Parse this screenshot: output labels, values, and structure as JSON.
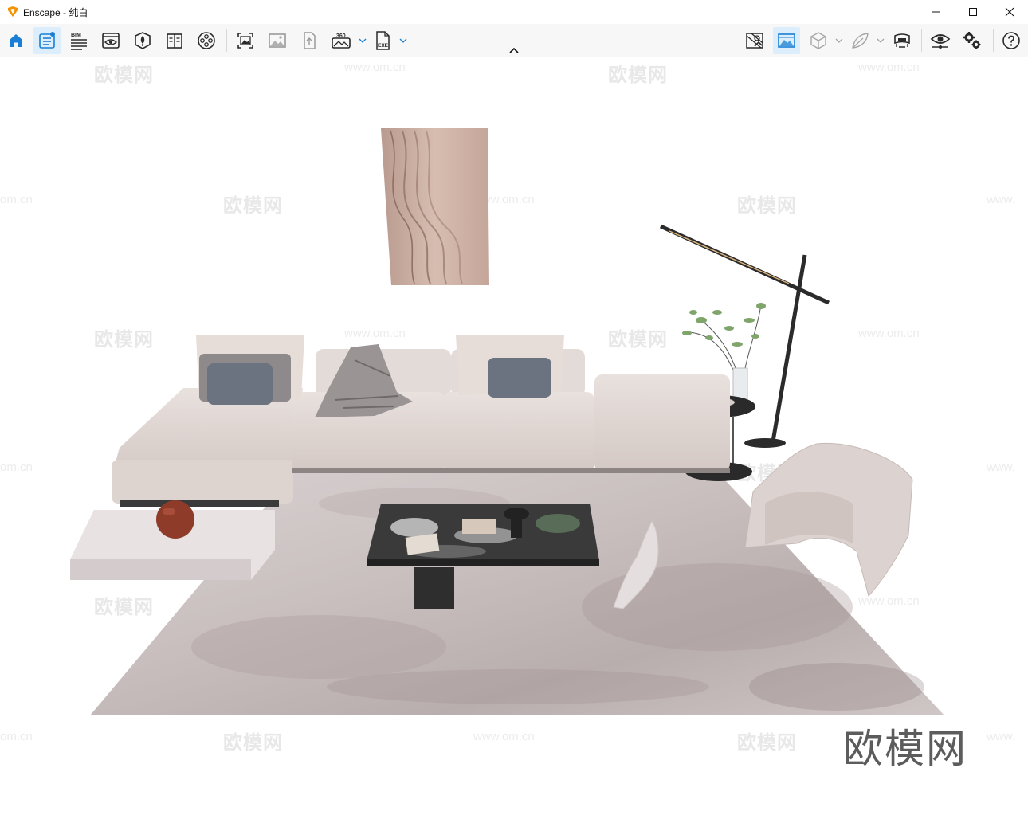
{
  "window": {
    "app_name": "Enscape",
    "separator": " - ",
    "scene_name": "纯白",
    "controls": [
      "minimize-icon",
      "maximize-icon",
      "close-icon"
    ]
  },
  "toolbar": {
    "bim_label": "BIM",
    "pano_label": "360",
    "exe_label": "EXE",
    "left_buttons": [
      "home-icon",
      "asset-library-icon",
      "bim-info-icon",
      "view-icon",
      "site-context-icon",
      "material-icon",
      "video-editor-icon",
      "screenshot-icon",
      "batch-render-icon",
      "upload-icon",
      "panorama-icon",
      "export-exe-icon"
    ],
    "right_buttons": [
      "map-icon",
      "atmosphere-icon",
      "cube-icon",
      "leaf-icon",
      "vr-headset-icon",
      "visual-settings-icon",
      "settings-icon",
      "help-icon"
    ]
  },
  "watermarks": {
    "brand": "欧模网",
    "url": "www.om.cn",
    "url_partial_left": "om.cn",
    "url_partial_right": "www."
  },
  "colors": {
    "accent": "#1a7fd4",
    "icon": "#2a2a2a",
    "active_bg": "#dceefb",
    "logo_orange": "#f29200"
  }
}
